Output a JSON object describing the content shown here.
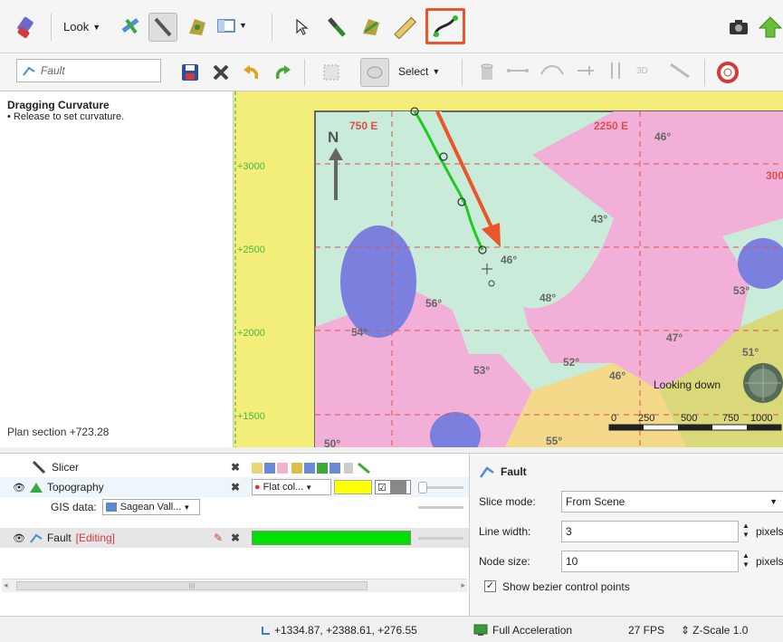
{
  "toolbar1": {
    "look_label": "Look"
  },
  "toolbar2": {
    "fault_placeholder": "Fault",
    "select_label": "Select"
  },
  "left_panel": {
    "title": "Dragging Curvature",
    "subtitle": "• Release to set curvature.",
    "plan_section": "Plan section +723.28"
  },
  "map": {
    "north_label": "N",
    "grid_labels_top": [
      "750 E",
      "2250 E"
    ],
    "partial_label": "300",
    "northings": [
      "+3000",
      "+2500",
      "+2000",
      "+1500"
    ],
    "dips": [
      "46°",
      "46°",
      "43°",
      "56°",
      "48°",
      "53°",
      "54°",
      "47°",
      "51°",
      "53°",
      "52°",
      "46°",
      "55°",
      "50°"
    ],
    "looking_down": "Looking down",
    "scale_labels": [
      "0",
      "250",
      "500",
      "750",
      "1000"
    ]
  },
  "tree": {
    "rows": [
      {
        "label": "Slicer"
      },
      {
        "label": "Topography",
        "render": "Flat col..."
      },
      {
        "label": "GIS data:",
        "value": "Sagean Vall..."
      },
      {
        "label": "Fault",
        "editing": "[Editing]"
      }
    ],
    "scroll_mark": "III"
  },
  "properties": {
    "title": "Fault",
    "slice_mode_label": "Slice mode:",
    "slice_mode_value": "From Scene",
    "line_width_label": "Line width:",
    "line_width_value": "3",
    "node_size_label": "Node size:",
    "node_size_value": "10",
    "unit_label": "pixels",
    "bezier_label": "Show bezier control points"
  },
  "status": {
    "coordinates": "+1334.87, +2388.61, +276.55",
    "acceleration": "Full Acceleration",
    "fps": "27 FPS",
    "zscale": "Z-Scale 1.0"
  },
  "colors": {
    "highlight": "#e8562a",
    "fault_line": "#22c922",
    "fault_color_swatch": "#00e000",
    "topography_swatch": "#ffff00"
  }
}
